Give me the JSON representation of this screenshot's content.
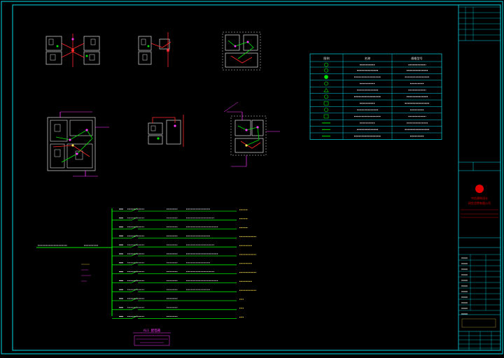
{
  "colors": {
    "background": "#000000",
    "border": "#00d7e6",
    "plan_outline": "#f2f2f2",
    "wire_green": "#00e600",
    "wire_magenta": "#ff36ff",
    "wire_red": "#ff2a2a",
    "text_green": "#00ff00",
    "text_yellow": "#ffe14a",
    "stamp_red": "#e00000"
  },
  "legend_table": {
    "header": [
      "图例",
      "名称",
      "规格型号"
    ]
  },
  "panel": {
    "title": "AL1 配电箱"
  },
  "title_block": {
    "company_line1": "中信建筑设计",
    "company_line2": "研究总院有限公司"
  }
}
